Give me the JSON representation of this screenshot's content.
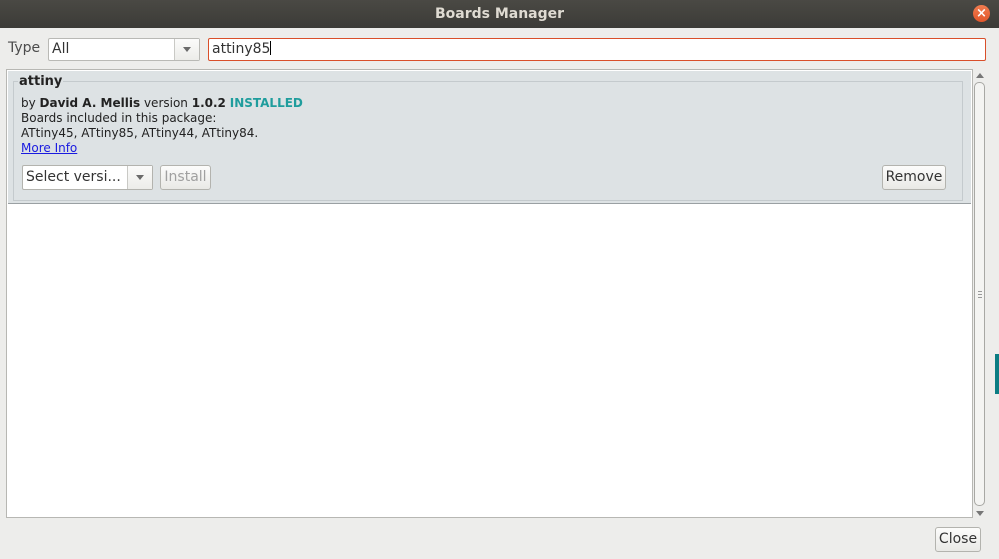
{
  "window": {
    "title": "Boards Manager",
    "close_glyph": "×"
  },
  "filter": {
    "type_label": "Type",
    "type_value": "All",
    "search_value": "attiny85"
  },
  "entry": {
    "name": "attiny",
    "by_prefix": "by",
    "author": "David A. Mellis",
    "version_prefix": "version",
    "version": "1.0.2",
    "status": "INSTALLED",
    "boards_heading": "Boards included in this package:",
    "boards_list": "ATtiny45, ATtiny85, ATtiny44, ATtiny84.",
    "more_info": "More Info",
    "version_select": "Select versi...",
    "install_label": "Install",
    "remove_label": "Remove"
  },
  "footer": {
    "close_label": "Close"
  },
  "colors": {
    "installed": "#1f9d9d",
    "search_focus": "#d94f2a",
    "entry_bg": "#dde2e4",
    "link": "#1a1ae0"
  },
  "icons": [
    "close-icon",
    "chevron-down-icon",
    "scroll-up-arrow-icon",
    "scroll-down-arrow-icon"
  ]
}
